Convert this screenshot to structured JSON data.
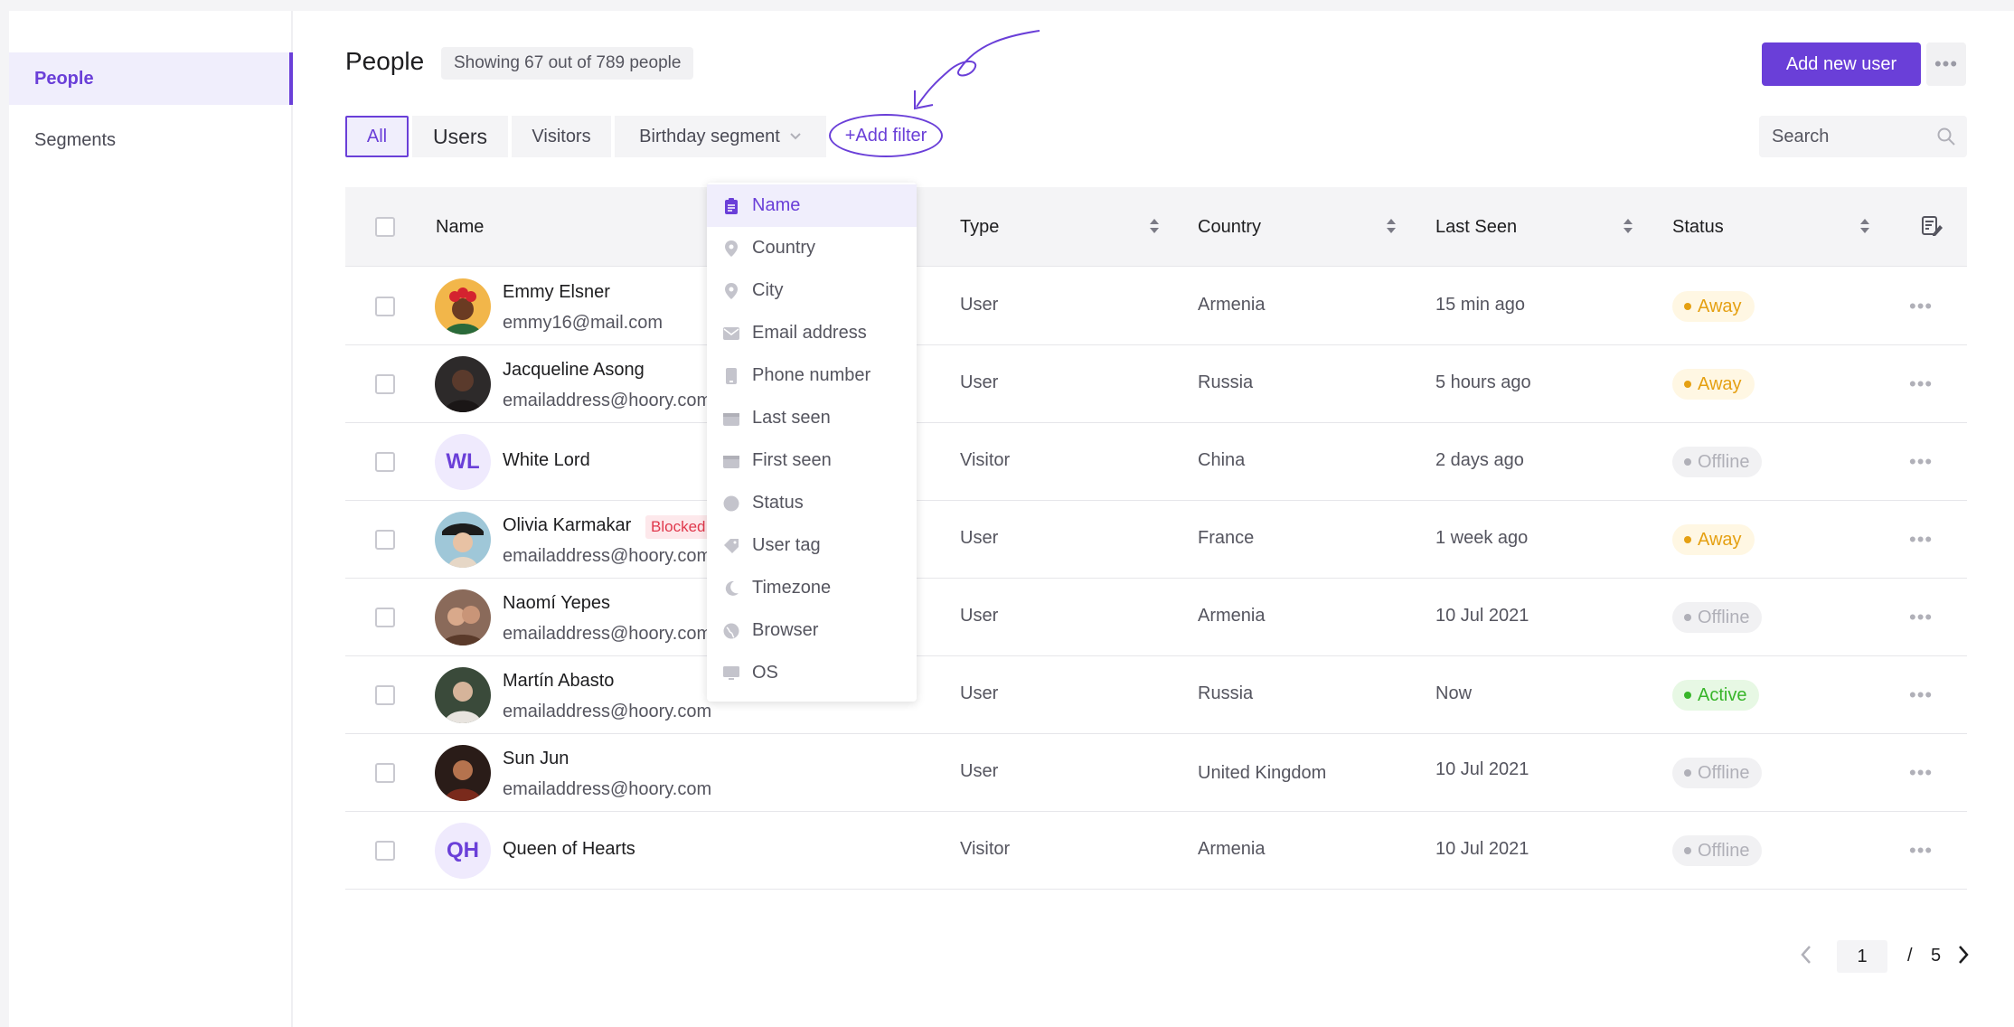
{
  "sidebar": {
    "items": [
      {
        "label": "People"
      },
      {
        "label": "Segments"
      }
    ]
  },
  "header": {
    "title": "People",
    "count": "Showing 67 out of 789 people",
    "add_button": "Add new user",
    "more_icon": "more-horizontal-icon"
  },
  "tabs": [
    {
      "label": "All"
    },
    {
      "label": "Users"
    },
    {
      "label": "Visitors"
    },
    {
      "label": "Birthday segment"
    }
  ],
  "add_filter": "+Add filter",
  "search": {
    "placeholder": "Search"
  },
  "table": {
    "columns": {
      "name": "Name",
      "type": "Type",
      "country": "Country",
      "last_seen": "Last Seen",
      "status": "Status"
    },
    "rows": [
      {
        "name": "Emmy Elsner",
        "email": "emmy16@mail.com",
        "type": "User",
        "country": "Armenia",
        "last_seen": "15 min ago",
        "status": "Away"
      },
      {
        "name": "Jacqueline Asong",
        "email": "emailaddress@hoory.com",
        "type": "User",
        "country": "Russia",
        "last_seen": "5 hours ago",
        "status": "Away"
      },
      {
        "name": "White Lord",
        "initials": "WL",
        "type": "Visitor",
        "country": "China",
        "last_seen": "2 days ago",
        "status": "Offline"
      },
      {
        "name": "Olivia Karmakar",
        "badge": "Blocked",
        "email": "emailaddress@hoory.com",
        "type": "User",
        "country": "France",
        "last_seen": "1 week ago",
        "status": "Away"
      },
      {
        "name": "Naomí Yepes",
        "email": "emailaddress@hoory.com",
        "type": "User",
        "country": "Armenia",
        "last_seen": "10 Jul 2021",
        "status": "Offline"
      },
      {
        "name": "Martín Abasto",
        "email": "emailaddress@hoory.com",
        "type": "User",
        "country": "Russia",
        "last_seen": "Now",
        "status": "Active"
      },
      {
        "name": "Sun Jun",
        "email": "emailaddress@hoory.com",
        "type": "User",
        "country": "United Kingdom",
        "last_seen": "10 Jul 2021",
        "status": "Offline"
      },
      {
        "name": "Queen of Hearts",
        "initials": "QH",
        "type": "Visitor",
        "country": "Armenia",
        "last_seen": "10 Jul 2021",
        "status": "Offline"
      }
    ]
  },
  "filter_menu": [
    {
      "label": "Name",
      "icon": "clipboard-icon"
    },
    {
      "label": "Country",
      "icon": "location-pin-icon"
    },
    {
      "label": "City",
      "icon": "location-pin-icon"
    },
    {
      "label": "Email address",
      "icon": "envelope-icon"
    },
    {
      "label": "Phone number",
      "icon": "phone-icon"
    },
    {
      "label": "Last seen",
      "icon": "calendar-icon"
    },
    {
      "label": "First seen",
      "icon": "calendar-icon"
    },
    {
      "label": "Status",
      "icon": "circle-icon"
    },
    {
      "label": "User tag",
      "icon": "tag-icon"
    },
    {
      "label": "Timezone",
      "icon": "moon-icon"
    },
    {
      "label": "Browser",
      "icon": "globe-icon"
    },
    {
      "label": "OS",
      "icon": "monitor-icon"
    }
  ],
  "pagination": {
    "current": "1",
    "separator": "/",
    "total": "5"
  },
  "colors": {
    "accent": "#6a3fd8",
    "away": "#e5a012",
    "active": "#38b52a",
    "offline": "#b0b0b8",
    "blocked": "#e0384c"
  }
}
